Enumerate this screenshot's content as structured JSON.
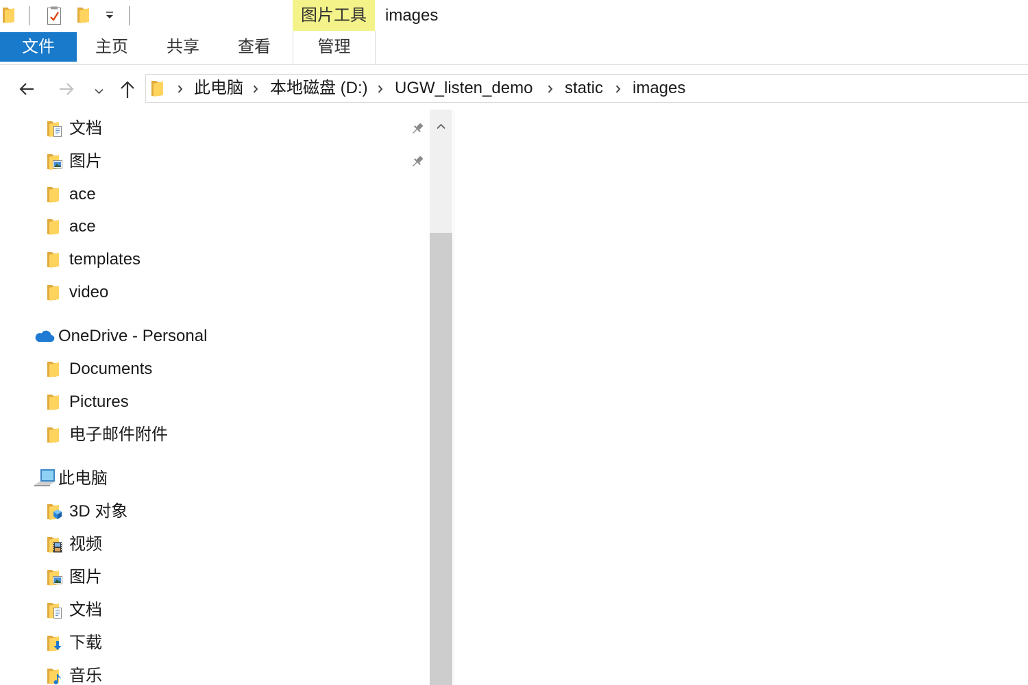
{
  "window": {
    "title": "images"
  },
  "quick_access_toolbar": {
    "icons": [
      "folder-icon",
      "properties-icon",
      "new-folder-icon",
      "customize-toolbar-dropdown-icon"
    ]
  },
  "ribbon": {
    "contextual_group_label": "图片工具",
    "file_tab_label": "文件",
    "tabs": [
      "主页",
      "共享",
      "查看"
    ],
    "contextual_tab_label": "管理"
  },
  "navigation_buttons": {
    "back": {
      "icon": "back-arrow-icon",
      "enabled": true
    },
    "forward": {
      "icon": "forward-arrow-icon",
      "enabled": false
    },
    "recent_locations": {
      "icon": "chevron-down-icon"
    },
    "up": {
      "icon": "up-arrow-icon",
      "enabled": true
    }
  },
  "address_bar": {
    "location_icon": "folder-icon",
    "breadcrumbs": [
      "此电脑",
      "本地磁盘 (D:)",
      "UGW_listen_demo",
      "static",
      "images"
    ]
  },
  "navigation_pane": {
    "quick_access_items": [
      {
        "label": "文档",
        "icon": "documents-folder-icon",
        "pinned": true
      },
      {
        "label": "图片",
        "icon": "pictures-folder-icon",
        "pinned": true
      },
      {
        "label": "ace",
        "icon": "folder-icon",
        "pinned": false
      },
      {
        "label": "ace",
        "icon": "folder-icon",
        "pinned": false
      },
      {
        "label": "templates",
        "icon": "folder-icon",
        "pinned": false
      },
      {
        "label": "video",
        "icon": "folder-icon",
        "pinned": false
      }
    ],
    "onedrive": {
      "label": "OneDrive - Personal",
      "icon": "onedrive-cloud-icon",
      "items": [
        {
          "label": "Documents",
          "icon": "folder-icon"
        },
        {
          "label": "Pictures",
          "icon": "folder-icon"
        },
        {
          "label": "电子邮件附件",
          "icon": "folder-icon"
        }
      ]
    },
    "this_pc": {
      "label": "此电脑",
      "icon": "computer-icon",
      "items": [
        {
          "label": "3D 对象",
          "icon": "3d-objects-folder-icon"
        },
        {
          "label": "视频",
          "icon": "videos-folder-icon"
        },
        {
          "label": "图片",
          "icon": "pictures-folder-icon"
        },
        {
          "label": "文档",
          "icon": "documents-folder-icon"
        },
        {
          "label": "下载",
          "icon": "downloads-folder-icon"
        },
        {
          "label": "音乐",
          "icon": "music-folder-icon"
        }
      ]
    }
  },
  "colors": {
    "file_tab_background": "#1979ca",
    "contextual_tab_background": "#f3f38a",
    "folder_yellow": "#ffd45e",
    "onedrive_blue": "#1f7ad4"
  }
}
